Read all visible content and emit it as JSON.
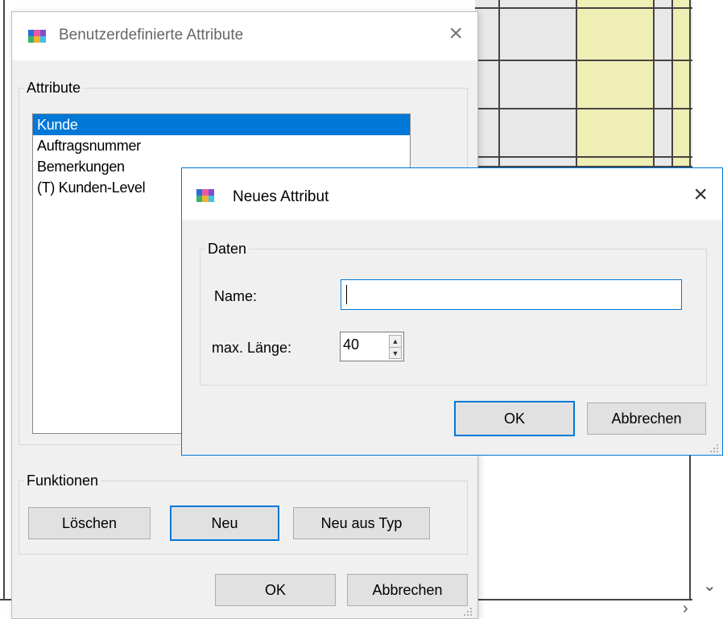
{
  "background": {
    "scroll_down_glyph": "⌄",
    "scroll_right_glyph": "›"
  },
  "custom_attributes_dialog": {
    "title": "Benutzerdefinierte Attribute",
    "close_glyph": "×",
    "icon": "app-icon",
    "attributes_group_label": "Attribute",
    "attributes": [
      {
        "label": "Kunde",
        "selected": true
      },
      {
        "label": "Auftragsnummer",
        "selected": false
      },
      {
        "label": "Bemerkungen",
        "selected": false
      },
      {
        "label": "(T) Kunden-Level",
        "selected": false
      }
    ],
    "functions_group_label": "Funktionen",
    "delete_label": "Löschen",
    "new_label": "Neu",
    "new_from_type_label": "Neu aus Typ",
    "ok_label": "OK",
    "cancel_label": "Abbrechen"
  },
  "new_attribute_dialog": {
    "title": "Neues Attribut",
    "close_glyph": "×",
    "icon": "app-icon",
    "data_group_label": "Daten",
    "name_label": "Name:",
    "name_value": "",
    "max_length_label": "max. Länge:",
    "max_length_value": "40",
    "spin_up_glyph": "▲",
    "spin_down_glyph": "▼",
    "ok_label": "OK",
    "cancel_label": "Abbrechen"
  },
  "colors": {
    "accent": "#0078d7",
    "grid_highlight": "#eeeeb5",
    "dialog_bg": "#f0f0f0"
  }
}
